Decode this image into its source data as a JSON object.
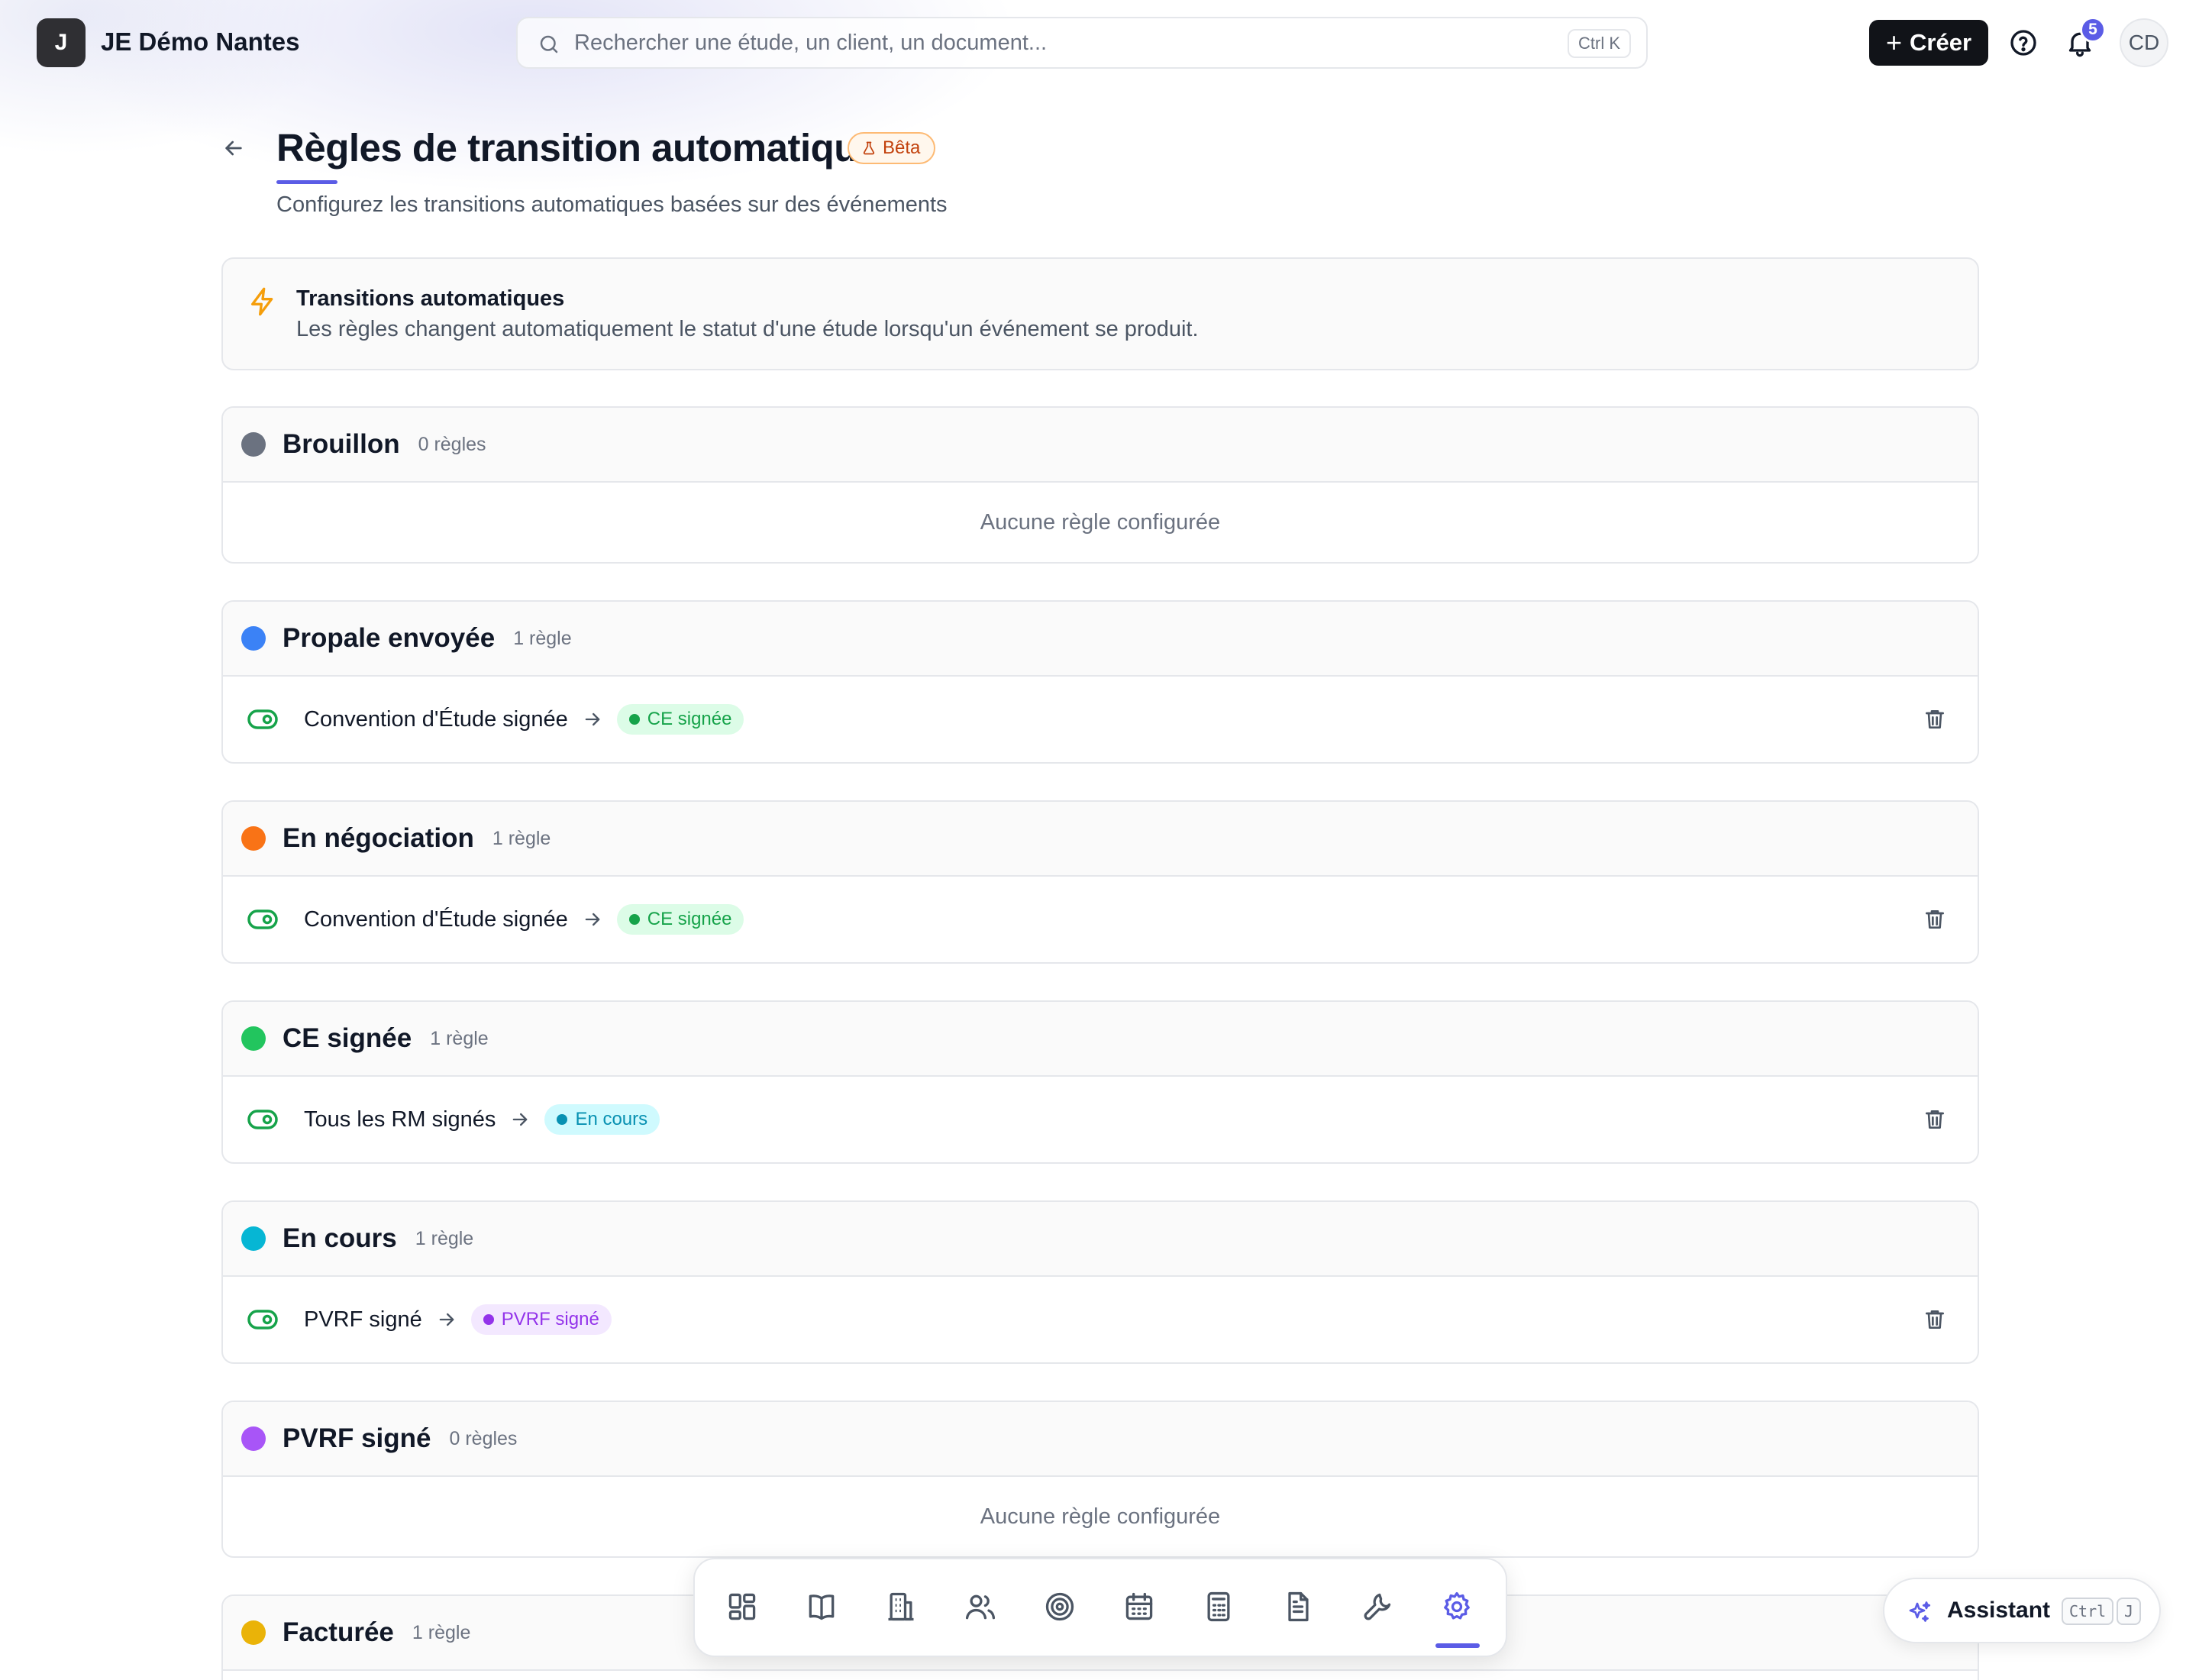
{
  "topbar": {
    "logo_letter": "J",
    "org_name": "JE Démo Nantes",
    "search_placeholder": "Rechercher une étude, un client, un document...",
    "search_shortcut": "Ctrl K",
    "create_label": "Créer",
    "notifications_count": "5",
    "avatar_initials": "CD"
  },
  "page": {
    "title": "Règles de transition automatique",
    "badge": "Bêta",
    "subtitle": "Configurez les transitions automatiques basées sur des événements"
  },
  "info": {
    "title": "Transitions automatiques",
    "description": "Les règles changent automatiquement le statut d'une étude lorsqu'un événement se produit."
  },
  "statuses": [
    {
      "name": "Brouillon",
      "count": "0 règles",
      "color": "#6b7280",
      "empty": "Aucune règle configurée"
    },
    {
      "name": "Propale envoyée",
      "count": "1 règle",
      "color": "#3b82f6",
      "rule": {
        "event": "Convention d'Étude signée",
        "target": "CE signée",
        "target_color": "#16a34a",
        "target_bg": "#dcfce7"
      }
    },
    {
      "name": "En négociation",
      "count": "1 règle",
      "color": "#f97316",
      "rule": {
        "event": "Convention d'Étude signée",
        "target": "CE signée",
        "target_color": "#16a34a",
        "target_bg": "#dcfce7"
      }
    },
    {
      "name": "CE signée",
      "count": "1 règle",
      "color": "#22c55e",
      "rule": {
        "event": "Tous les RM signés",
        "target": "En cours",
        "target_color": "#0891b2",
        "target_bg": "#cffafe"
      }
    },
    {
      "name": "En cours",
      "count": "1 règle",
      "color": "#06b6d4",
      "rule": {
        "event": "PVRF signé",
        "target": "PVRF signé",
        "target_color": "#9333ea",
        "target_bg": "#f3e8ff"
      }
    },
    {
      "name": "PVRF signé",
      "count": "0 règles",
      "color": "#a855f7",
      "empty": "Aucune règle configurée"
    },
    {
      "name": "Facturée",
      "count": "1 règle",
      "color": "#eab308"
    }
  ],
  "dock": {
    "items": [
      "dashboard-icon",
      "book-icon",
      "building-icon",
      "users-icon",
      "target-icon",
      "calendar-icon",
      "calculator-icon",
      "document-icon",
      "wrench-icon",
      "settings-icon"
    ],
    "active": "settings-icon"
  },
  "assistant": {
    "label": "Assistant",
    "key1": "Ctrl",
    "key2": "J"
  },
  "colors": {
    "accent": "#5b5ce6",
    "toggle_on": "#16a34a"
  }
}
